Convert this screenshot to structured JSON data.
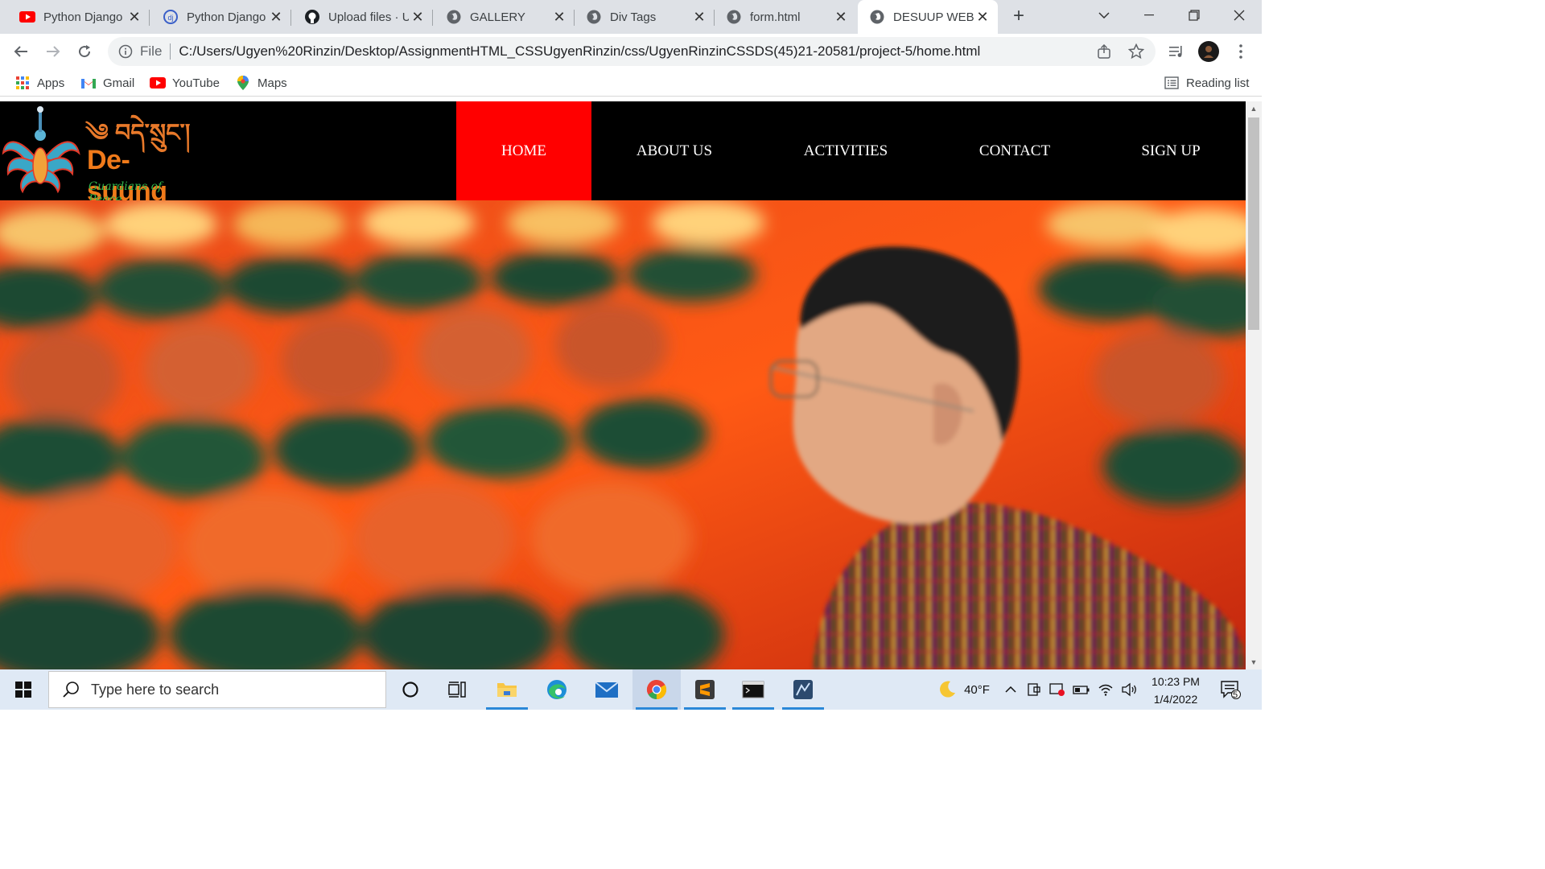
{
  "browser": {
    "tabs": [
      {
        "title": "Python Django",
        "icon": "youtube-icon"
      },
      {
        "title": "Python Django",
        "icon": "django-tab-icon"
      },
      {
        "title": "Upload files · U",
        "icon": "github-icon"
      },
      {
        "title": "GALLERY",
        "icon": "globe-icon"
      },
      {
        "title": "Div Tags",
        "icon": "globe-icon"
      },
      {
        "title": "form.html",
        "icon": "globe-icon"
      },
      {
        "title": "DESUUP WEBS",
        "icon": "globe-icon",
        "active": true
      }
    ],
    "omnibox": {
      "scheme": "File",
      "url": "C:/Users/Ugyen%20Rinzin/Desktop/AssignmentHTML_CSSUgyenRinzin/css/UgyenRinzinCSSDS(45)21-20581/project-5/home.html"
    },
    "bookmarks": [
      {
        "label": "Apps",
        "icon": "apps-grid-icon"
      },
      {
        "label": "Gmail",
        "icon": "gmail-icon"
      },
      {
        "label": "YouTube",
        "icon": "youtube-icon"
      },
      {
        "label": "Maps",
        "icon": "maps-pin-icon"
      }
    ],
    "reading_list": "Reading list"
  },
  "site": {
    "logo": {
      "script": "༄ བདེ་སྲུང་།",
      "name": "De-suung",
      "tagline": "Guardians of Peace"
    },
    "nav": [
      {
        "label": "HOME",
        "active": true
      },
      {
        "label": "ABOUT US"
      },
      {
        "label": "ACTIVITIES"
      },
      {
        "label": "CONTACT"
      },
      {
        "label": "SIGN UP"
      }
    ],
    "colors": {
      "nav_bg": "#000000",
      "active_nav": "#ff0000",
      "logo_orange": "#f07a1a",
      "logo_green": "#2fb34a"
    }
  },
  "taskbar": {
    "search_placeholder": "Type here to search",
    "weather": "40°F",
    "time": "10:23 PM",
    "date": "1/4/2022",
    "notifications": "5"
  }
}
